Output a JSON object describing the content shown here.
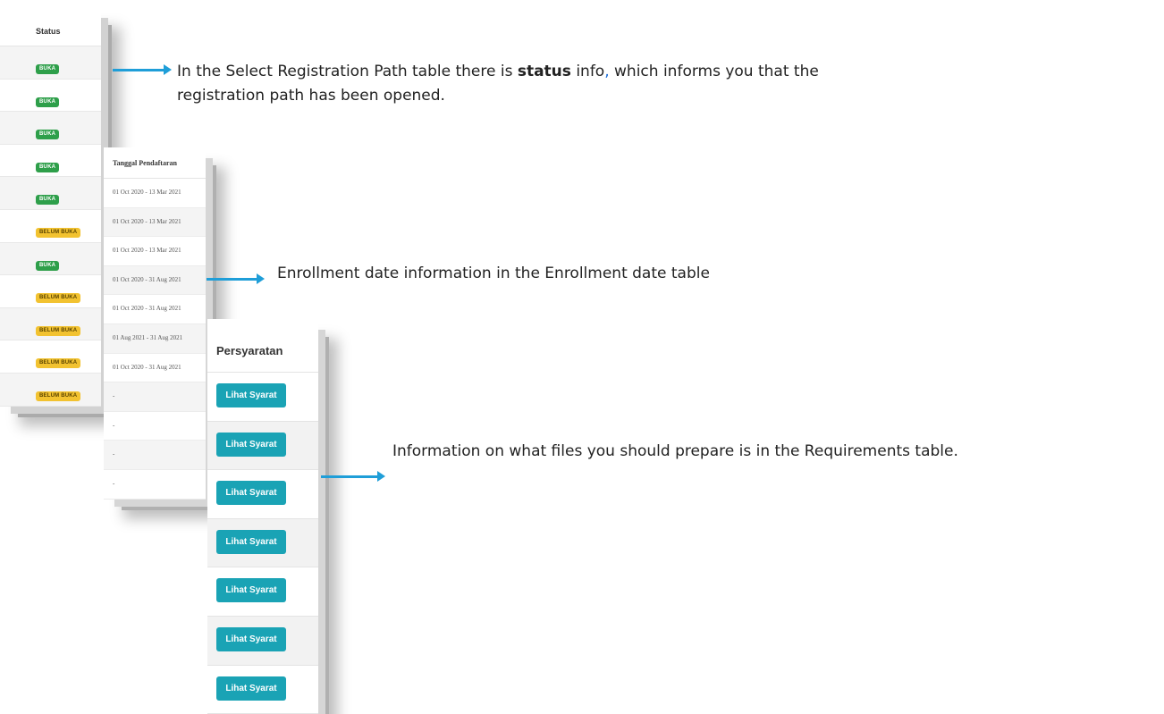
{
  "status_table": {
    "header": "Status",
    "rows": [
      {
        "label": "BUKA",
        "kind": "buka"
      },
      {
        "label": "BUKA",
        "kind": "buka"
      },
      {
        "label": "BUKA",
        "kind": "buka"
      },
      {
        "label": "BUKA",
        "kind": "buka"
      },
      {
        "label": "BUKA",
        "kind": "buka"
      },
      {
        "label": "BELUM BUKA",
        "kind": "belum"
      },
      {
        "label": "BUKA",
        "kind": "buka"
      },
      {
        "label": "BELUM BUKA",
        "kind": "belum"
      },
      {
        "label": "BELUM BUKA",
        "kind": "belum"
      },
      {
        "label": "BELUM BUKA",
        "kind": "belum"
      },
      {
        "label": "BELUM BUKA",
        "kind": "belum"
      }
    ]
  },
  "date_table": {
    "header": "Tanggal Pendaftaran",
    "rows": [
      "01 Oct 2020 - 13 Mar 2021",
      "01 Oct 2020 - 13 Mar 2021",
      "01 Oct 2020 - 13 Mar 2021",
      "01 Oct 2020 - 31 Aug 2021",
      "01 Oct 2020 - 31 Aug 2021",
      "01 Aug 2021 - 31 Aug 2021",
      "01 Oct 2020 - 31 Aug 2021",
      "-",
      "-",
      "-",
      "-"
    ]
  },
  "requirements_table": {
    "header": "Persyaratan",
    "button_label": "Lihat Syarat",
    "row_count": 7
  },
  "annotations": {
    "status_pre": "In the Select Registration Path table there is ",
    "status_bold": "status",
    "status_mid": " info",
    "status_comma": ",",
    "status_post": " which informs you that the",
    "status_line2": "registration path has been opened.",
    "enrollment": "Enrollment date information in the Enrollment date table",
    "requirements": "Information on what files you should prepare is in the Requirements table."
  },
  "colors": {
    "accent_arrow": "#1f9ed8",
    "badge_open": "#2e9f4a",
    "badge_not_open": "#f2c230",
    "button": "#1aa3b5"
  }
}
